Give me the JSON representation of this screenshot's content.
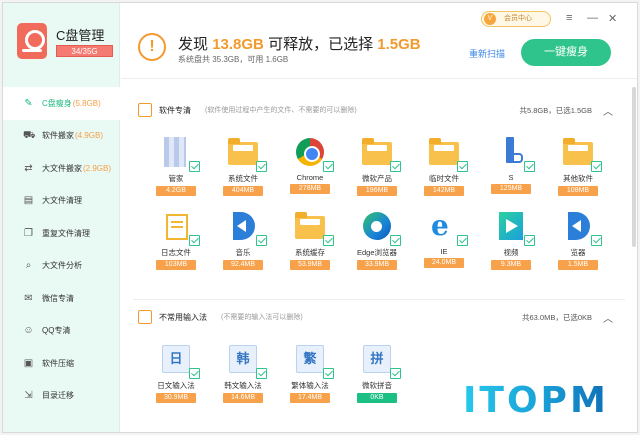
{
  "app": {
    "title": "C盘管理",
    "capacity": "34/35G"
  },
  "window": {
    "vip_label": "会员中心",
    "vip_avatar": "V",
    "menu_icon": "≡",
    "minimize_icon": "—",
    "close_icon": "✕"
  },
  "nav": [
    {
      "label": "C盘瘦身",
      "size": "(5.8GB)",
      "icon": "broom-icon",
      "glyph": "✎",
      "active": true
    },
    {
      "label": "软件搬家",
      "size": "(4.9GB)",
      "icon": "truck-icon",
      "glyph": "⛟",
      "active": false
    },
    {
      "label": "大文件搬家",
      "size": "(2.9GB)",
      "icon": "file-move-icon",
      "glyph": "⇄",
      "active": false
    },
    {
      "label": "大文件清理",
      "size": "",
      "icon": "file-clean-icon",
      "glyph": "▤",
      "active": false
    },
    {
      "label": "重复文件清理",
      "size": "",
      "icon": "duplicate-icon",
      "glyph": "❐",
      "active": false
    },
    {
      "label": "大文件分析",
      "size": "",
      "icon": "analysis-icon",
      "glyph": "⌕",
      "active": false
    },
    {
      "label": "微信专清",
      "size": "",
      "icon": "wechat-icon",
      "glyph": "✉",
      "active": false
    },
    {
      "label": "QQ专清",
      "size": "",
      "icon": "qq-icon",
      "glyph": "☺",
      "active": false
    },
    {
      "label": "软件压缩",
      "size": "",
      "icon": "compress-icon",
      "glyph": "▣",
      "active": false
    },
    {
      "label": "目录迁移",
      "size": "",
      "icon": "migrate-icon",
      "glyph": "⇲",
      "active": false
    }
  ],
  "header": {
    "title_prefix": "发现",
    "releasable": "13.8GB",
    "title_mid": "可释放，已选择",
    "selected": "1.5GB",
    "subtitle": "系统盘共 35.3GB，可用 1.6GB",
    "warn_icon": "!",
    "rescan": "重新扫描",
    "oneclick": "一键瘦身"
  },
  "software_section": {
    "title": "软件专清",
    "desc": "(软件使用过程中产生的文件、不需要的可以删除)",
    "summary": "共5.8GB，已选1.5GB",
    "toggle": "︿",
    "items": [
      {
        "label": "管家",
        "size": "4.2GB",
        "kind": "blur",
        "color": "orange"
      },
      {
        "label": "系统文件",
        "size": "404MB",
        "kind": "folder",
        "color": "orange"
      },
      {
        "label": "Chrome",
        "size": "278MB",
        "kind": "chrome",
        "color": "orange"
      },
      {
        "label": "微软产品",
        "size": "196MB",
        "kind": "folder",
        "color": "orange"
      },
      {
        "label": "临时文件",
        "size": "142MB",
        "kind": "folder",
        "color": "orange"
      },
      {
        "label": "S",
        "size": "125MB",
        "kind": "stick",
        "color": "orange"
      },
      {
        "label": "其他软件",
        "size": "108MB",
        "kind": "folder",
        "color": "orange"
      },
      {
        "label": "日志文件",
        "size": "103MB",
        "kind": "doc",
        "color": "orange"
      },
      {
        "label": "音乐",
        "size": "92.4MB",
        "kind": "blue-app",
        "color": "orange"
      },
      {
        "label": "系统缓存",
        "size": "53.9MB",
        "kind": "folder",
        "color": "orange"
      },
      {
        "label": "Edge浏览器",
        "size": "33.9MB",
        "kind": "edge",
        "color": "orange"
      },
      {
        "label": "IE",
        "size": "24.0MB",
        "kind": "ie",
        "color": "orange"
      },
      {
        "label": "视频",
        "size": "9.3MB",
        "kind": "tv",
        "color": "orange"
      },
      {
        "label": "览器",
        "size": "1.5MB",
        "kind": "blue-app",
        "color": "orange"
      }
    ]
  },
  "ime_section": {
    "title": "不常用输入法",
    "desc": "(不需要的输入法可以删除)",
    "summary": "共63.0MB，已选0KB",
    "toggle": "︿",
    "items": [
      {
        "label": "日文输入法",
        "size": "30.9MB",
        "char": "日",
        "color": "orange"
      },
      {
        "label": "韩文输入法",
        "size": "14.6MB",
        "char": "韩",
        "color": "orange"
      },
      {
        "label": "繁体输入法",
        "size": "17.4MB",
        "char": "繁",
        "color": "orange"
      },
      {
        "label": "微软拼音",
        "size": "0KB",
        "char": "拼",
        "color": "green"
      }
    ]
  },
  "watermark": "ITOPM"
}
